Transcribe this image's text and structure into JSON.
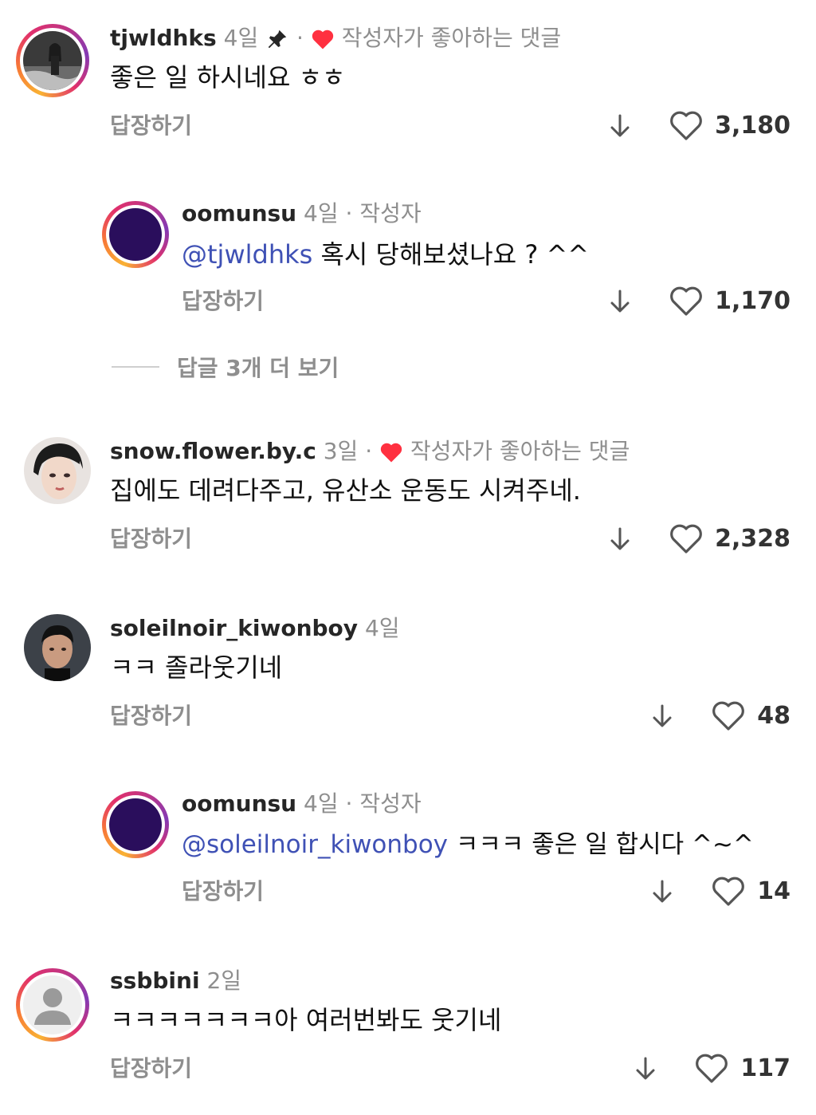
{
  "comments": [
    {
      "username": "tjwldhks",
      "time": "4일",
      "pinned": true,
      "creator_liked_label": "작성자가 좋아하는 댓글",
      "text": "좋은 일 하시네요 ㅎㅎ",
      "reply_label": "답장하기",
      "likes": "3,180"
    },
    {
      "username": "oomunsu",
      "time": "4일",
      "author_label": "작성자",
      "mention": "@tjwldhks",
      "text": " 혹시 당해보셨나요 ? ^^",
      "reply_label": "답장하기",
      "likes": "1,170"
    },
    {
      "username": "snow.flower.by.c",
      "time": "3일",
      "creator_liked_label": "작성자가 좋아하는 댓글",
      "text": "집에도 데려다주고, 유산소 운동도 시켜주네.",
      "reply_label": "답장하기",
      "likes": "2,328"
    },
    {
      "username": "soleilnoir_kiwonboy",
      "time": "4일",
      "text": "ㅋㅋ 졸라웃기네",
      "reply_label": "답장하기",
      "likes": "48"
    },
    {
      "username": "oomunsu",
      "time": "4일",
      "author_label": "작성자",
      "mention": "@soleilnoir_kiwonboy",
      "text": " ㅋㅋㅋ 좋은 일 합시다 ^~^",
      "reply_label": "답장하기",
      "likes": "14"
    },
    {
      "username": "ssbbini",
      "time": "2일",
      "text": "ㅋㅋㅋㅋㅋㅋㅋ아 여러번봐도 웃기네",
      "reply_label": "답장하기",
      "likes": "117"
    }
  ],
  "more_replies_label": "답글 3개 더 보기",
  "colors": {
    "mention": "#3f51b5",
    "heart_red": "#ff3040",
    "muted": "#8e8e8e",
    "author_avatar": "#2a0e5c"
  },
  "icons": [
    "pin-icon",
    "heart-icon",
    "download-arrow-icon",
    "default-avatar-icon"
  ]
}
